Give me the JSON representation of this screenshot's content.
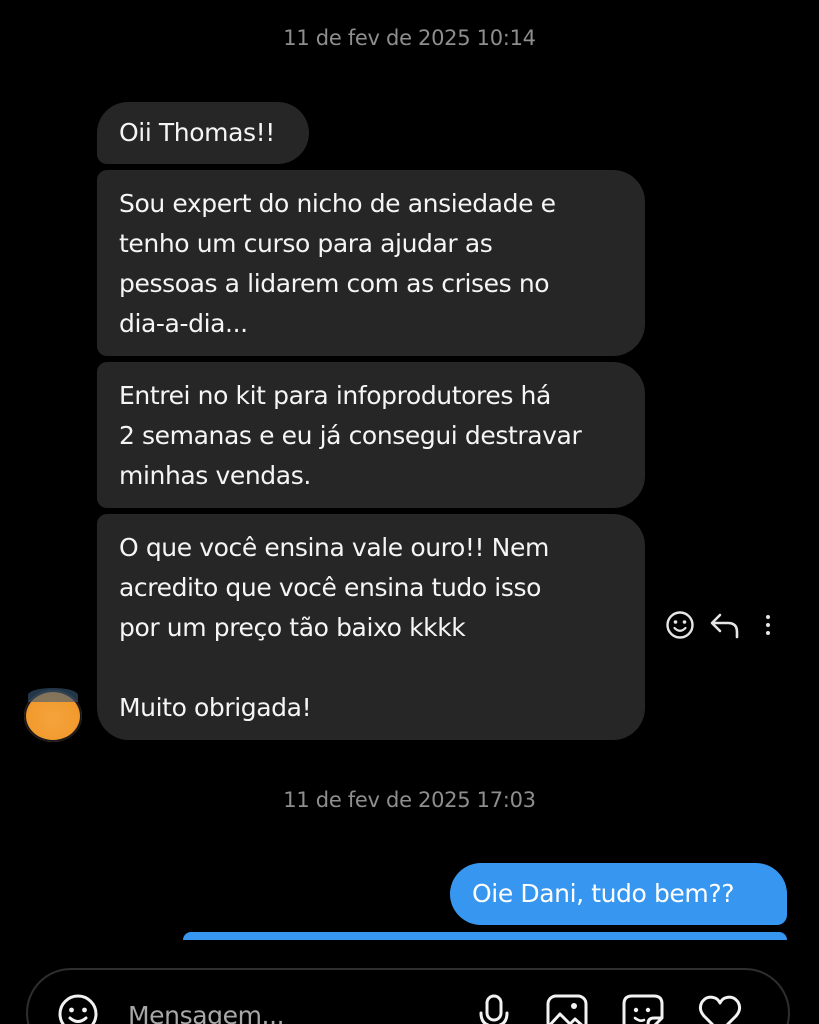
{
  "thread": {
    "timestamps": [
      "11 de fev de 2025 10:14",
      "11 de fev de 2025 17:03"
    ],
    "incoming": [
      "Oii Thomas!!",
      "Sou expert do nicho de ansiedade e\ntenho um curso para ajudar as\npessoas a lidarem com as crises no\ndia-a-dia...",
      "Entrei no kit para infoprodutores há\n2 semanas e eu já consegui destravar\nminhas vendas.",
      "O que você ensina vale ouro!! Nem\nacredito que você ensina tudo isso\npor um preço tão baixo kkkk\n\nMuito obrigada!"
    ],
    "outgoing": [
      "Oie Dani, tudo bem??"
    ]
  },
  "message_actions": {
    "icons": [
      "smiley-icon",
      "reply-icon",
      "more-icon"
    ]
  },
  "composer": {
    "placeholder": "Mensagem...",
    "icons": [
      "emoji-icon",
      "microphone-icon",
      "image-icon",
      "sticker-icon",
      "heart-icon"
    ]
  },
  "colors": {
    "background": "#000000",
    "incoming_bubble": "#262626",
    "outgoing_bubble": "#3797f0",
    "timestamp": "#8e8e8e"
  }
}
